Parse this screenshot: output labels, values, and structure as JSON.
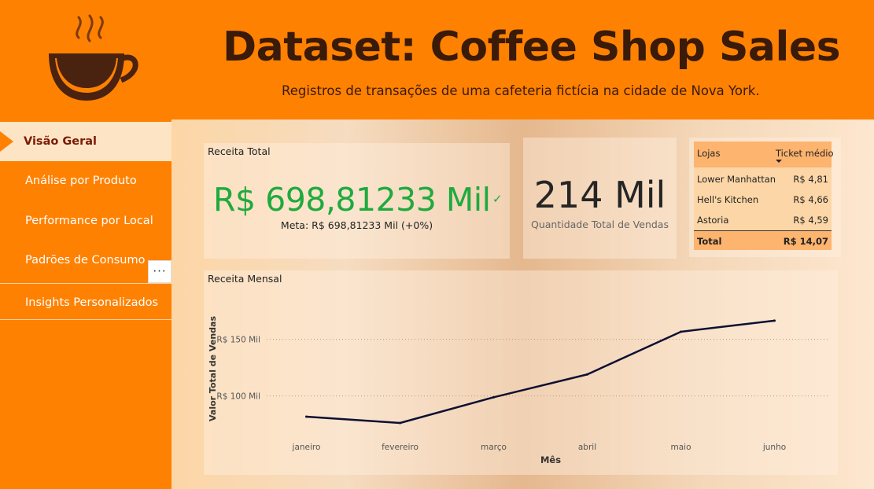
{
  "header": {
    "title": "Dataset: Coffee Shop Sales",
    "subtitle": "Registros de transações de uma cafeteria fictícia na cidade de Nova York.",
    "logo_icon": "coffee-cup-icon"
  },
  "sidebar": {
    "items": [
      {
        "label": "Visão Geral",
        "active": true
      },
      {
        "label": "Análise por Produto",
        "active": false
      },
      {
        "label": "Performance por Local",
        "active": false
      },
      {
        "label": "Padrões de Consumo",
        "active": false
      },
      {
        "label": "Insights Personalizados",
        "active": false
      }
    ],
    "more_label": "···"
  },
  "kpi_revenue": {
    "title": "Receita Total",
    "value": "R$ 698,81233 Mil",
    "check": "✓",
    "goal": "Meta: R$ 698,81233 Mil (+0%)"
  },
  "kpi_count": {
    "value": "214 Mil",
    "label": "Quantidade Total de Vendas"
  },
  "ticket_table": {
    "headers": [
      "Lojas",
      "Ticket médio"
    ],
    "rows": [
      {
        "store": "Lower Manhattan",
        "value": "R$ 4,81"
      },
      {
        "store": "Hell's Kitchen",
        "value": "R$ 4,66"
      },
      {
        "store": "Astoria",
        "value": "R$ 4,59"
      }
    ],
    "total_label": "Total",
    "total_value": "R$ 14,07"
  },
  "colors": {
    "accent_orange": "#fe8102",
    "kpi_green": "#1faa3e",
    "line_navy": "#0d1033",
    "dark_brown": "#3a1a08"
  },
  "chart_data": {
    "type": "line",
    "title": "Receita Mensal",
    "xlabel": "Mês",
    "ylabel": "Valor Total de Vendas",
    "categories": [
      "janeiro",
      "fevereiro",
      "março",
      "abril",
      "maio",
      "junho"
    ],
    "series": [
      {
        "values": [
          81.7,
          76.1,
          98.8,
          119.0,
          156.7,
          166.5
        ]
      }
    ],
    "yticks": [
      {
        "value": 100,
        "label": "R$ 100 Mil"
      },
      {
        "value": 150,
        "label": "R$ 150 Mil"
      }
    ],
    "ylim": [
      65,
      190
    ],
    "grid": true
  }
}
